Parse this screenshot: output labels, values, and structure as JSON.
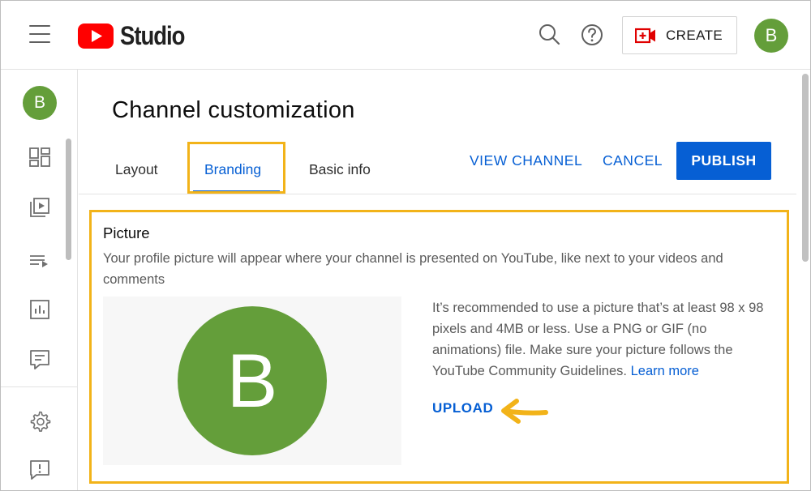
{
  "header": {
    "logo_text": "Studio",
    "create_label": "CREATE",
    "avatar_letter": "B"
  },
  "sidebar": {
    "avatar_letter": "B",
    "items": [
      "dashboard-icon",
      "content-icon",
      "playlists-icon",
      "analytics-icon",
      "comments-icon",
      "settings-icon",
      "feedback-icon"
    ]
  },
  "main": {
    "title": "Channel customization",
    "tabs": [
      {
        "label": "Layout",
        "active": false
      },
      {
        "label": "Branding",
        "active": true
      },
      {
        "label": "Basic info",
        "active": false
      }
    ],
    "view_channel": "VIEW CHANNEL",
    "cancel": "CANCEL",
    "publish": "PUBLISH"
  },
  "picture": {
    "title": "Picture",
    "description": "Your profile picture will appear where your channel is presented on YouTube, like next to your videos and comments",
    "avatar_letter": "B",
    "recommendation": "It’s recommended to use a picture that’s at least 98 x 98 pixels and 4MB or less. Use a PNG or GIF (no animations) file. Make sure your picture follows the YouTube Community Guidelines.",
    "learn_more": "Learn more",
    "upload": "UPLOAD"
  },
  "colors": {
    "accent": "#065fd4",
    "avatar": "#649e3a",
    "highlight": "#f2b319",
    "youtube_red": "#ff0000"
  }
}
